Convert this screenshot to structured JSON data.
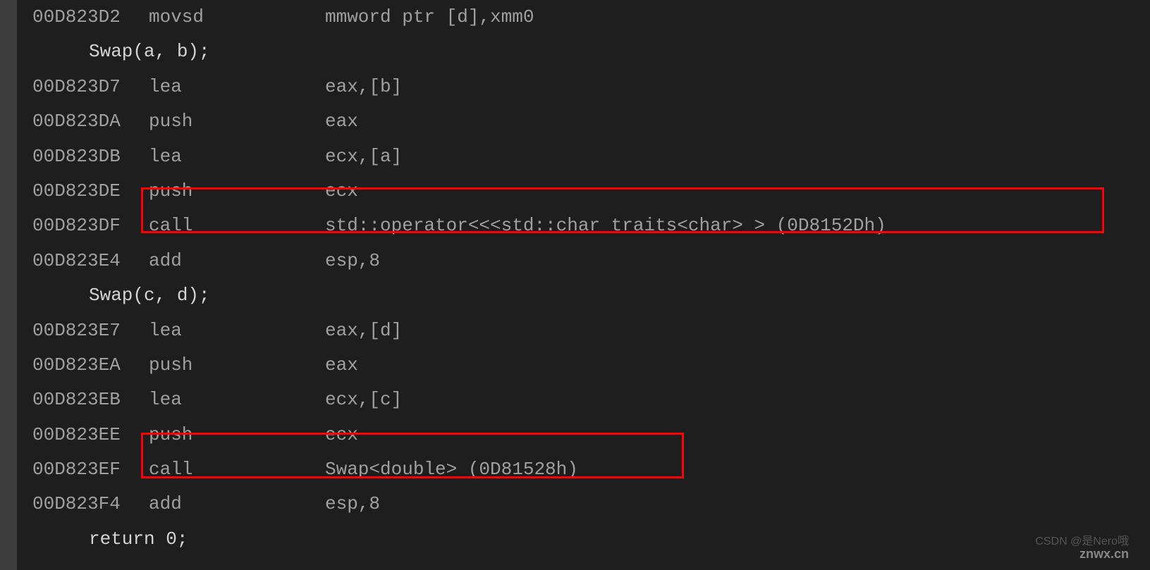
{
  "lines": [
    {
      "addr": "00D823D2",
      "mnemonic": "movsd",
      "operand": "mmword ptr [d],xmm0"
    },
    {
      "source": "Swap(a, b);"
    },
    {
      "addr": "00D823D7",
      "mnemonic": "lea",
      "operand": "eax,[b]"
    },
    {
      "addr": "00D823DA",
      "mnemonic": "push",
      "operand": "eax"
    },
    {
      "addr": "00D823DB",
      "mnemonic": "lea",
      "operand": "ecx,[a]"
    },
    {
      "addr": "00D823DE",
      "mnemonic": "push",
      "operand": "ecx"
    },
    {
      "addr": "00D823DF",
      "mnemonic": "call",
      "operand": "std::operator<<<std::char_traits<char> > (0D8152Dh)"
    },
    {
      "addr": "00D823E4",
      "mnemonic": "add",
      "operand": "esp,8"
    },
    {
      "source": "Swap(c, d);"
    },
    {
      "addr": "00D823E7",
      "mnemonic": "lea",
      "operand": "eax,[d]"
    },
    {
      "addr": "00D823EA",
      "mnemonic": "push",
      "operand": "eax"
    },
    {
      "addr": "00D823EB",
      "mnemonic": "lea",
      "operand": "ecx,[c]"
    },
    {
      "addr": "00D823EE",
      "mnemonic": "push",
      "operand": "ecx"
    },
    {
      "addr": "00D823EF",
      "mnemonic": "call",
      "operand": "Swap<double> (0D81528h)"
    },
    {
      "addr": "00D823F4",
      "mnemonic": "add",
      "operand": "esp,8"
    },
    {
      "source": "return 0;"
    }
  ],
  "watermark1": "CSDN @是Nero哦",
  "watermark2": "znwx.cn"
}
